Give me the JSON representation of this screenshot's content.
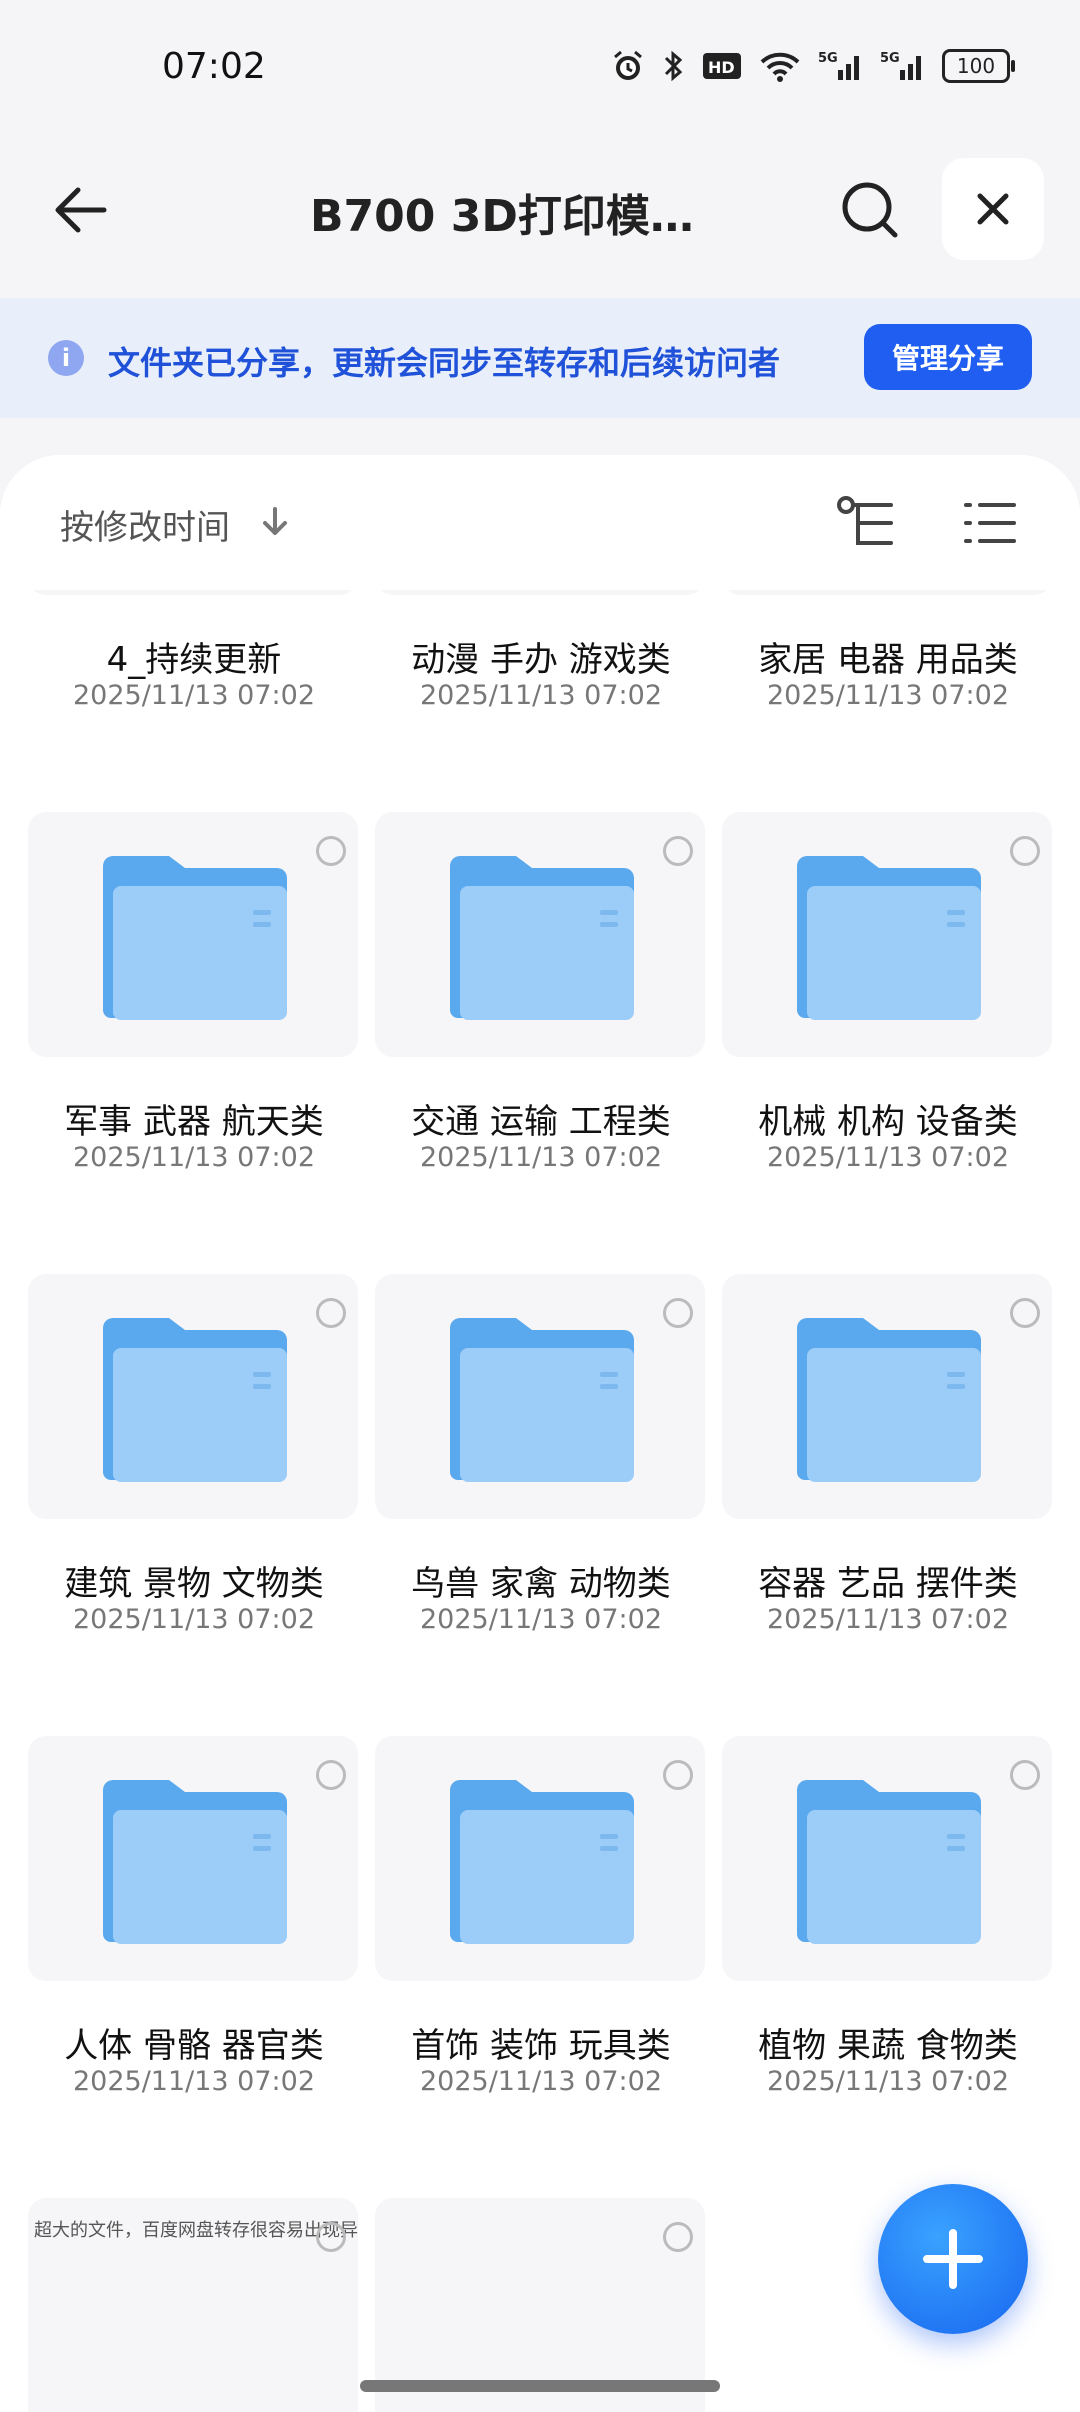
{
  "status_bar": {
    "time": "07:02",
    "battery": "100",
    "signal1": "5G",
    "signal2": "5G",
    "hd": "HD"
  },
  "header": {
    "title": "B700 3D打印模型..."
  },
  "banner": {
    "text": "文件夹已分享，更新会同步至转存和后续访问者",
    "button": "管理分享"
  },
  "sort": {
    "label": "按修改时间"
  },
  "colors": {
    "accent": "#1f5ef0",
    "folder": "#7cbcf6"
  },
  "folders": [
    {
      "name": "4_持续更新",
      "date": "2025/11/13 07:02"
    },
    {
      "name": "动漫 手办 游戏类",
      "date": "2025/11/13 07:02"
    },
    {
      "name": "家居 电器 用品类",
      "date": "2025/11/13 07:02"
    },
    {
      "name": "军事 武器 航天类",
      "date": "2025/11/13 07:02"
    },
    {
      "name": "交通 运输 工程类",
      "date": "2025/11/13 07:02"
    },
    {
      "name": "机械 机构 设备类",
      "date": "2025/11/13 07:02"
    },
    {
      "name": "建筑 景物 文物类",
      "date": "2025/11/13 07:02"
    },
    {
      "name": "鸟兽 家禽 动物类",
      "date": "2025/11/13 07:02"
    },
    {
      "name": "容器 艺品 摆件类",
      "date": "2025/11/13 07:02"
    },
    {
      "name": "人体 骨骼 器官类",
      "date": "2025/11/13 07:02"
    },
    {
      "name": "首饰 装饰 玩具类",
      "date": "2025/11/13 07:02"
    },
    {
      "name": "植物 果蔬 食物类",
      "date": "2025/11/13 07:02"
    }
  ],
  "partial_file": {
    "text": "超大的文件，百度网盘转存很容易出现异常"
  }
}
